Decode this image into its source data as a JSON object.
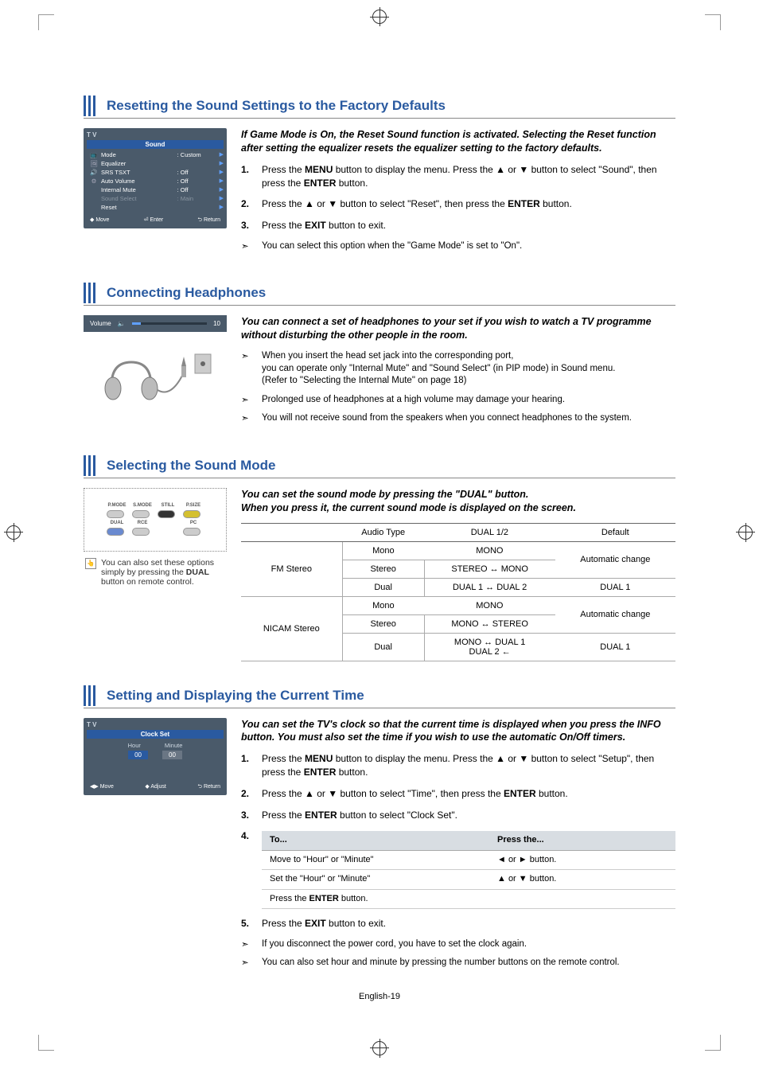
{
  "page_number": "English-19",
  "sections": {
    "reset": {
      "title": "Resetting the Sound Settings to the Factory Defaults",
      "intro": "If Game Mode is On, the Reset Sound function is activated. Selecting the Reset function after setting the equalizer resets the equalizer setting to the factory defaults.",
      "step1a": "Press the ",
      "step1b": " button to display the menu. Press the ▲ or ▼ button to select \"Sound\", then press the ",
      "step1c": " button.",
      "step2a": "Press the ▲ or ▼ button to select \"Reset\", then press the ",
      "step2b": " button.",
      "step3a": "Press the ",
      "step3b": " button to exit.",
      "note": "You can select this option when the \"Game Mode\" is set to \"On\".",
      "osd": {
        "title": "T V",
        "header": "Sound",
        "rows": [
          {
            "label": "Mode",
            "val": ": Custom"
          },
          {
            "label": "Equalizer",
            "val": ""
          },
          {
            "label": "SRS TSXT",
            "val": ": Off"
          },
          {
            "label": "Auto Volume",
            "val": ": Off"
          },
          {
            "label": "Internal Mute",
            "val": ": Off"
          },
          {
            "label": "Sound Select",
            "val": ": Main"
          },
          {
            "label": "Reset",
            "val": ""
          }
        ],
        "foot_move": "Move",
        "foot_enter": "Enter",
        "foot_return": "Return"
      }
    },
    "headphones": {
      "title": "Connecting Headphones",
      "intro": "You can connect a set of headphones to your set if you wish to watch a TV programme without disturbing the other people in the room.",
      "note1a": "When you insert the head set jack into the corresponding port,",
      "note1b": "you can operate only \"Internal Mute\" and \"Sound Select\" (in PIP mode) in Sound menu.",
      "note1c": "(Refer to \"Selecting the Internal Mute\" on page 18)",
      "note2": "Prolonged use of headphones at a high volume may damage your hearing.",
      "note3": "You will not receive sound from the speakers when you connect headphones to the system.",
      "vol_label": "Volume",
      "vol_value": "10"
    },
    "soundmode": {
      "title": "Selecting the Sound Mode",
      "intro_a": "You can set the sound mode by pressing the \"DUAL\" button.",
      "intro_b": "When you press it, the current sound mode is displayed on the screen.",
      "tip_a": "You can also set these options simply by pressing the ",
      "tip_b": " button on remote control.",
      "btn": {
        "pmode": "P.MODE",
        "smode": "S.MODE",
        "still": "STILL",
        "psize": "P.SIZE",
        "dual": "DUAL",
        "pc": "PC",
        "srce": "RCE"
      },
      "table": {
        "h_audio": "Audio Type",
        "h_dual": "DUAL 1/2",
        "h_default": "Default",
        "fm": "FM Stereo",
        "nicam": "NICAM Stereo",
        "mono": "Mono",
        "stereo": "Stereo",
        "dual": "Dual",
        "v_mono": "MONO",
        "v_stereo_mono": "STEREO ↔ MONO",
        "v_dual12": "DUAL 1 ↔ DUAL 2",
        "v_mono_stereo": "MONO ↔ STEREO",
        "v_mono_dual": "MONO ↔ DUAL 1\nDUAL 2 ←",
        "auto": "Automatic change",
        "dual1": "DUAL 1"
      }
    },
    "time": {
      "title": "Setting and Displaying the Current Time",
      "intro": "You can set the TV's clock so that the current time is displayed when you press the INFO button. You must also set the time if you wish to use the automatic On/Off timers.",
      "step1a": "Press the ",
      "step1b": " button to display the menu. Press the ▲ or ▼ button to select \"Setup\", then press the ",
      "step1c": " button.",
      "step2a": "Press the ▲ or ▼ button to select \"Time\", then press the ",
      "step2b": " button.",
      "step3a": "Press the ",
      "step3b": " button to select \"Clock Set\".",
      "step5a": "Press the ",
      "step5b": " button to exit.",
      "note1": "If you disconnect the power cord, you have to set the clock again.",
      "note2": "You can also set hour and minute by pressing the number buttons on the remote control.",
      "table": {
        "h_to": "To...",
        "h_press": "Press the...",
        "r1": "Move to \"Hour\" or \"Minute\"",
        "r1b": "◄  or  ► button.",
        "r2": "Set the \"Hour\" or \"Minute\"",
        "r2b": "▲  or  ▼ button.",
        "r3a": "Press the ",
        "r3b": " button."
      },
      "osd": {
        "title": "T V",
        "header": "Clock Set",
        "hour": "Hour",
        "minute": "Minute",
        "hval": "00",
        "mval": "00",
        "foot_move": "Move",
        "foot_adjust": "Adjust",
        "foot_return": "Return"
      }
    }
  },
  "labels": {
    "menu": "MENU",
    "enter": "ENTER",
    "exit": "EXIT",
    "dual": "DUAL"
  }
}
